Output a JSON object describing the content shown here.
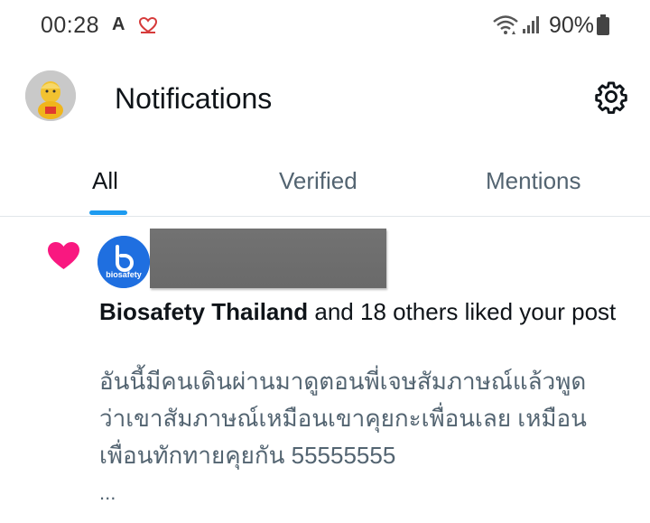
{
  "status_bar": {
    "time": "00:28",
    "indicator_letter": "A",
    "battery_percent": "90%"
  },
  "header": {
    "title": "Notifications"
  },
  "tabs": [
    {
      "label": "All",
      "active": true
    },
    {
      "label": "Verified",
      "active": false
    },
    {
      "label": "Mentions",
      "active": false
    }
  ],
  "notification": {
    "type_icon": "heart-icon",
    "avatar_text": "biosafety",
    "actor": "Biosafety Thailand",
    "action_text": " and 18 others liked your post",
    "post_line_1": "อันนี้มีคนเดินผ่านมาดูตอนพี่เจษสัมภาษณ์แล้วพูด",
    "post_line_2": "ว่าเขาสัมภาษณ์เหมือนเขาคุยกะเพื่อนเลย เหมือน",
    "post_line_3": "เพื่อนทักทายคุยกัน 55555555",
    "ellipsis": "..."
  },
  "colors": {
    "accent": "#1d9bf0",
    "like": "#f91880",
    "secondary_text": "#536471",
    "primary_text": "#0f1419"
  }
}
